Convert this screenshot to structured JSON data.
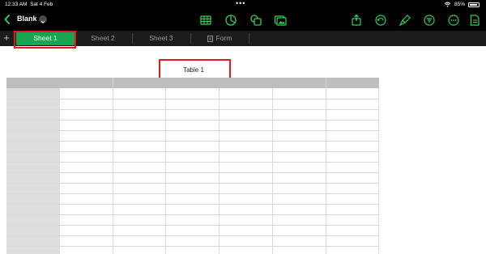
{
  "status": {
    "time": "12:33 AM",
    "date": "Sat 4 Feb",
    "battery": "85%",
    "battery_level": 0.85
  },
  "toolbar": {
    "doc_title": "Blank",
    "icons": [
      "table-icon",
      "chart-icon",
      "shapes-icon",
      "media-icon",
      "share-icon",
      "undo-icon",
      "format-brush-icon",
      "filter-icon",
      "more-icon",
      "document-icon"
    ]
  },
  "tabs": {
    "items": [
      {
        "label": "Sheet 1",
        "active": true
      },
      {
        "label": "Sheet 2",
        "active": false
      },
      {
        "label": "Sheet 3",
        "active": false
      },
      {
        "label": "Form",
        "active": false
      }
    ]
  },
  "sheet": {
    "table_title": "Table 1"
  },
  "colors": {
    "accent_green": "#17a54d",
    "highlight_red": "#e3191b",
    "ios_green_icon": "#30d158"
  }
}
